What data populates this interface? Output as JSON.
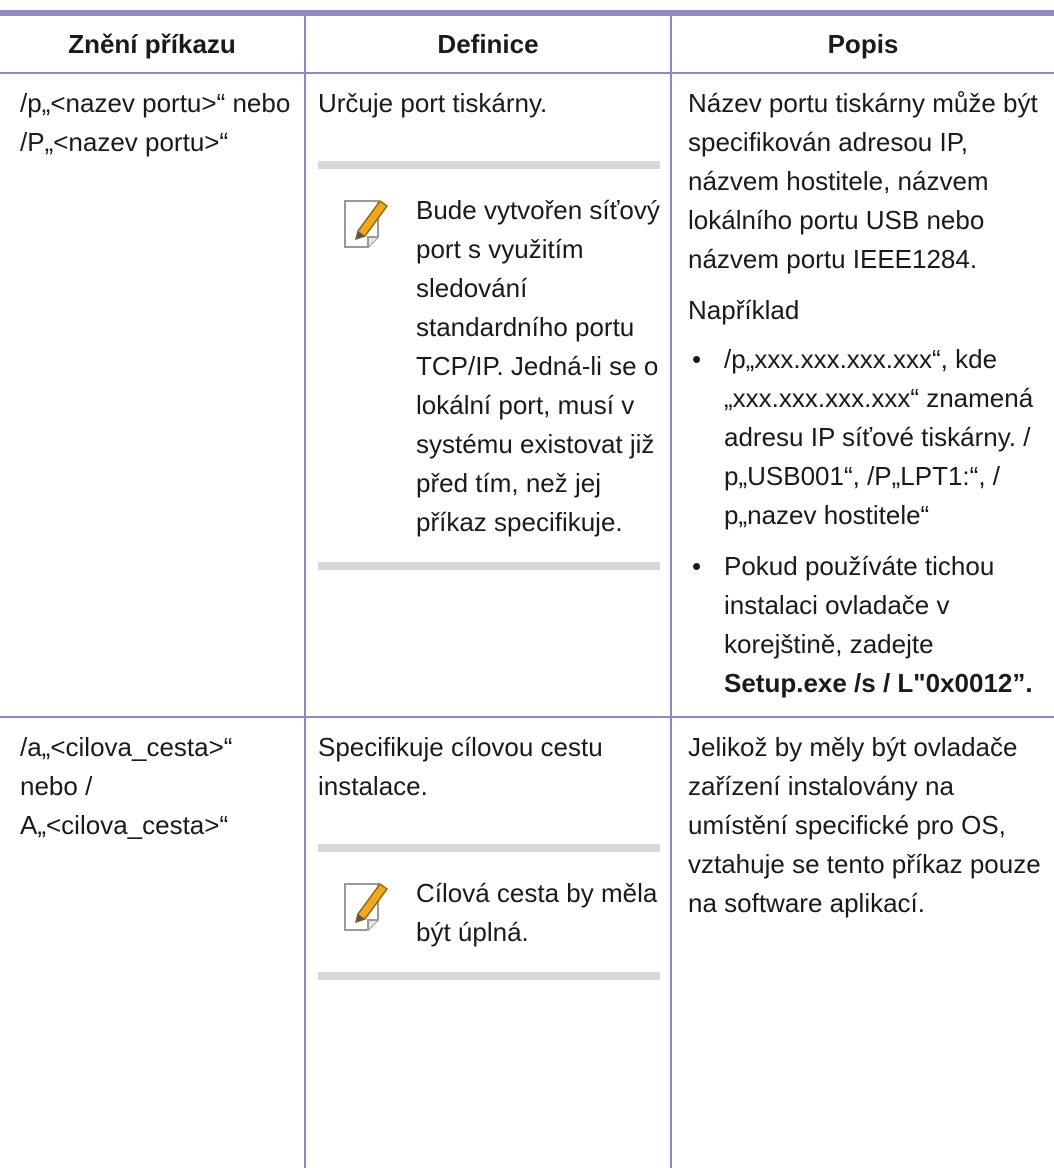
{
  "headers": {
    "command": "Znění příkazu",
    "definition": "Definice",
    "description": "Popis"
  },
  "rows": [
    {
      "command": "/p„<nazev portu>“ nebo /P„<nazev portu>“",
      "definition": "Určuje port tiskárny.",
      "note": "Bude vytvořen síťový port s využitím sledování standardního portu TCP/IP. Jedná-li se o lokální port, musí v systému existovat již před tím, než jej příkaz specifikuje.",
      "description": "Název portu tiskárny může být specifikován adresou IP, názvem hostitele, názvem lokálního portu USB nebo názvem portu IEEE1284.",
      "example_label": "Například",
      "bullets": [
        {
          "text": "/p„xxx.xxx.xxx.xxx“, kde „xxx.xxx.xxx.xxx“ znamená adresu IP síťové tiskárny. / p„USB001“, /P„LPT1:“, / p„nazev hostitele“"
        },
        {
          "text": "Pokud používáte tichou instalaci ovladače v korejštině, zadejte ",
          "bold": "Setup.exe /s / L\"0x0012”."
        }
      ]
    },
    {
      "command": "/a„<cilova_cesta>“ nebo / A„<cilova_cesta>“",
      "definition": "Specifikuje cílovou cestu instalace.",
      "note": "Cílová cesta by měla být úplná.",
      "description": "Jelikož by měly být ovladače zařízení instalovány na umístění specifické pro OS, vztahuje se tento příkaz pouze na software aplikací."
    }
  ],
  "icons": {
    "note": "note-pencil-icon"
  },
  "colors": {
    "rule": "#8b8bc2",
    "note_bar": "#d8d8d8",
    "icon_pencil": "#f2a81d"
  }
}
